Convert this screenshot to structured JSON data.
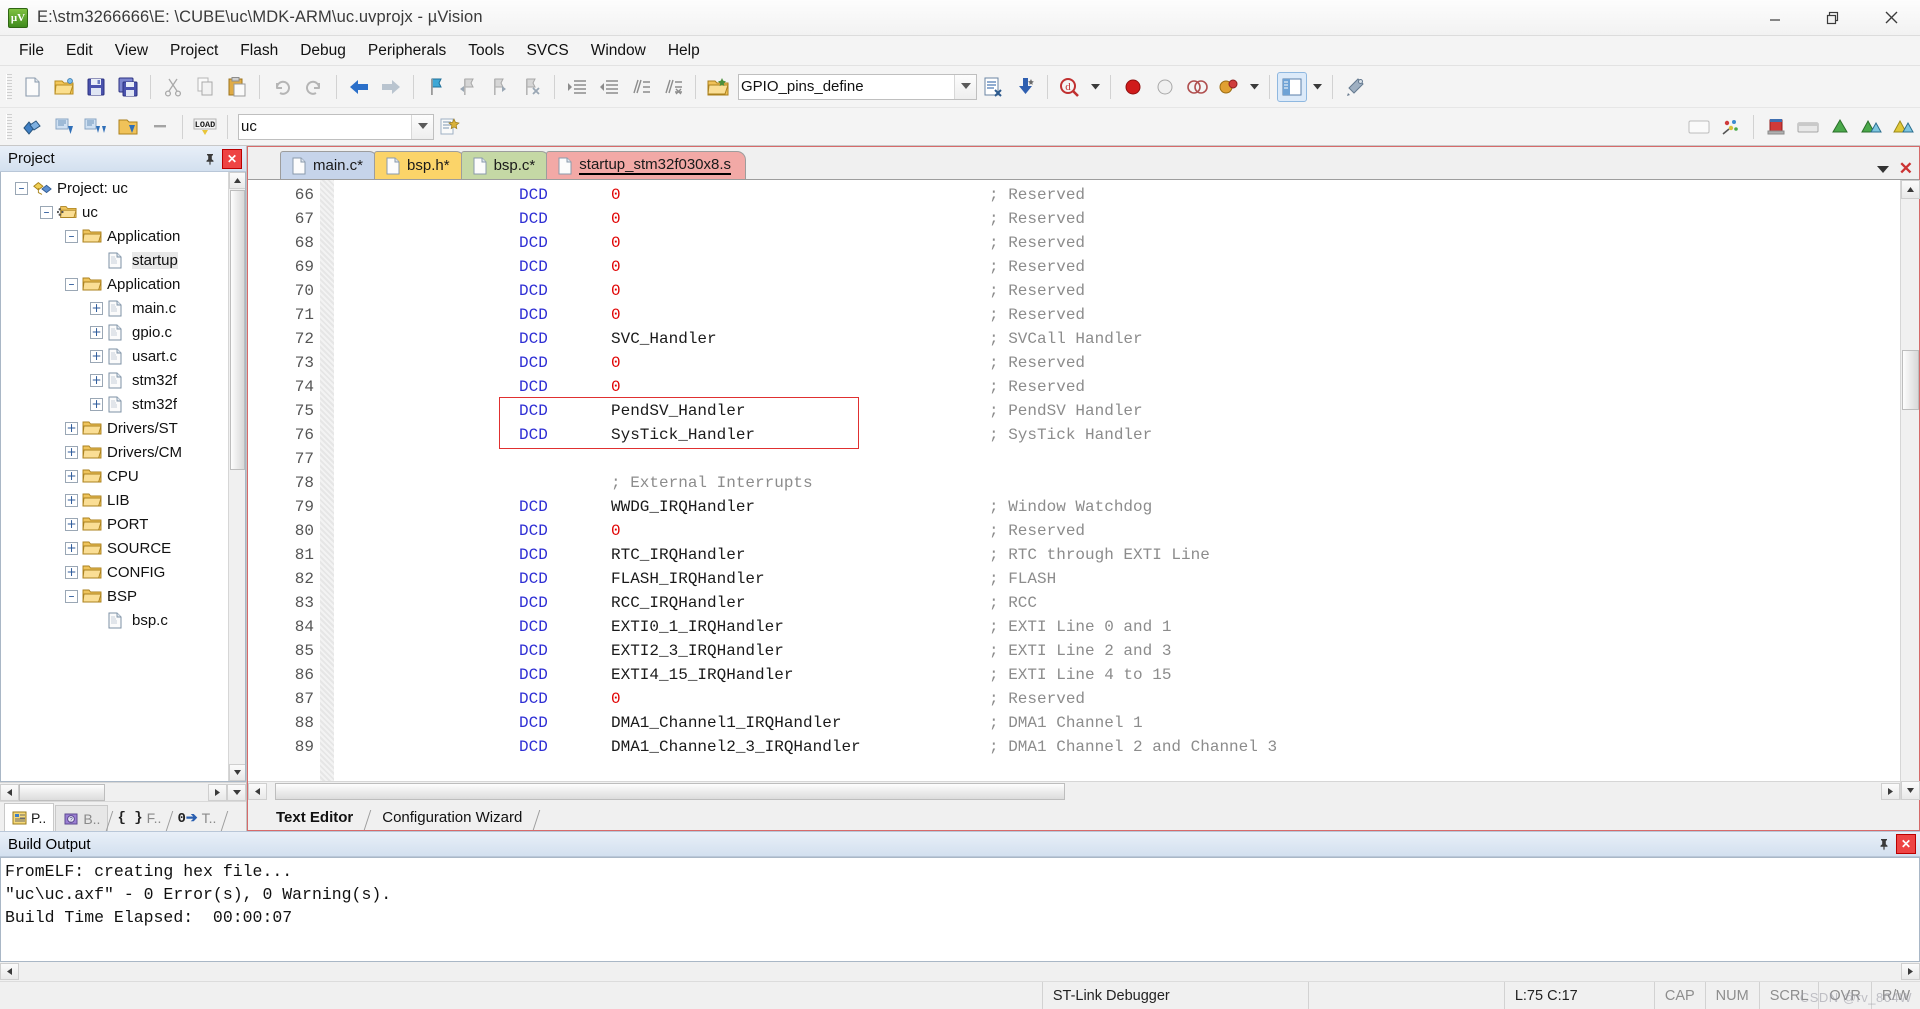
{
  "window": {
    "title": "E:\\stm3266666\\E:  \\CUBE\\uc\\MDK-ARM\\uc.uvprojx - µVision",
    "logo_text": "μV",
    "minimize_label": "Minimize",
    "maximize_label": "Restore",
    "close_label": "Close"
  },
  "menubar": {
    "items": [
      {
        "label": "File"
      },
      {
        "label": "Edit"
      },
      {
        "label": "View"
      },
      {
        "label": "Project"
      },
      {
        "label": "Flash"
      },
      {
        "label": "Debug"
      },
      {
        "label": "Peripherals"
      },
      {
        "label": "Tools"
      },
      {
        "label": "SVCS"
      },
      {
        "label": "Window"
      },
      {
        "label": "Help"
      }
    ]
  },
  "toolbar_main": {
    "buttons": [
      {
        "name": "new-file-icon",
        "title": "New"
      },
      {
        "name": "open-file-icon",
        "title": "Open"
      },
      {
        "name": "save-icon",
        "title": "Save"
      },
      {
        "name": "save-all-icon",
        "title": "Save All"
      },
      {
        "name": "cut-icon",
        "title": "Cut"
      },
      {
        "name": "copy-icon",
        "title": "Copy"
      },
      {
        "name": "paste-icon",
        "title": "Paste"
      },
      {
        "name": "undo-icon",
        "title": "Undo"
      },
      {
        "name": "redo-icon",
        "title": "Redo"
      },
      {
        "name": "navigate-back-icon",
        "title": "Back"
      },
      {
        "name": "navigate-forward-icon",
        "title": "Forward"
      },
      {
        "name": "bookmark-toggle-icon",
        "title": "Insert/Remove Bookmark"
      },
      {
        "name": "bookmark-prev-icon",
        "title": "Previous Bookmark"
      },
      {
        "name": "bookmark-next-icon",
        "title": "Next Bookmark"
      },
      {
        "name": "bookmark-clear-icon",
        "title": "Clear All Bookmarks"
      },
      {
        "name": "indent-icon",
        "title": "Indent"
      },
      {
        "name": "outdent-icon",
        "title": "Outdent"
      },
      {
        "name": "comment-icon",
        "title": "Comment"
      },
      {
        "name": "uncomment-icon",
        "title": "Uncomment"
      }
    ],
    "target_combo": {
      "value": "GPIO_pins_define",
      "icon": "target-options-icon"
    },
    "after_combo": [
      {
        "name": "target-options-icon",
        "title": "Options for Target"
      },
      {
        "name": "manage-runtime-icon",
        "title": "Manage Run-Time Environment"
      },
      {
        "name": "start-debug-icon",
        "title": "Start/Stop Debug Session"
      },
      {
        "name": "stop-icon",
        "title": "Stop"
      },
      {
        "name": "insert-breakpoint-icon",
        "title": "Insert/Remove Breakpoint"
      },
      {
        "name": "disable-breakpoint-icon",
        "title": "Enable/Disable Breakpoint"
      },
      {
        "name": "kill-breakpoints-icon",
        "title": "Kill All Breakpoints"
      },
      {
        "name": "window-layout-icon",
        "title": "Window Layout"
      },
      {
        "name": "configure-icon",
        "title": "Configuration"
      }
    ]
  },
  "toolbar_build": {
    "buttons": [
      {
        "name": "translate-icon",
        "title": "Translate"
      },
      {
        "name": "build-icon",
        "title": "Build"
      },
      {
        "name": "rebuild-icon",
        "title": "Rebuild"
      },
      {
        "name": "batch-build-icon",
        "title": "Batch Build"
      },
      {
        "name": "stop-build-icon",
        "title": "Stop Build"
      },
      {
        "name": "download-icon",
        "title": "Download (LOAD)"
      }
    ],
    "project_combo": {
      "value": "uc"
    },
    "right_buttons": [
      {
        "name": "target-options-icon",
        "title": "Options for Target"
      },
      {
        "name": "manage-components-icon",
        "title": "Manage Project Items"
      },
      {
        "name": "book-icon",
        "title": "Books"
      },
      {
        "name": "functions-icon",
        "title": "Functions"
      },
      {
        "name": "templates-icon",
        "title": "Templates"
      }
    ]
  },
  "project_panel": {
    "title": "Project",
    "pin_icon": "pin-icon",
    "close_icon": "close-icon",
    "tree": [
      {
        "depth": 0,
        "expander": "minus",
        "icon": "project-icon",
        "label": "Project: uc",
        "selected": false
      },
      {
        "depth": 1,
        "expander": "minus",
        "icon": "target-icon",
        "label": "uc",
        "selected": false
      },
      {
        "depth": 2,
        "expander": "minus",
        "icon": "folder-icon",
        "label": "Application",
        "selected": false
      },
      {
        "depth": 3,
        "expander": "none",
        "icon": "file-icon",
        "label": "startup",
        "selected": true
      },
      {
        "depth": 2,
        "expander": "minus",
        "icon": "folder-icon",
        "label": "Application",
        "selected": false
      },
      {
        "depth": 3,
        "expander": "plus",
        "icon": "file-icon",
        "label": "main.c",
        "selected": false
      },
      {
        "depth": 3,
        "expander": "plus",
        "icon": "file-icon",
        "label": "gpio.c",
        "selected": false
      },
      {
        "depth": 3,
        "expander": "plus",
        "icon": "file-icon",
        "label": "usart.c",
        "selected": false
      },
      {
        "depth": 3,
        "expander": "plus",
        "icon": "file-icon",
        "label": "stm32f",
        "selected": false
      },
      {
        "depth": 3,
        "expander": "plus",
        "icon": "file-icon",
        "label": "stm32f",
        "selected": false
      },
      {
        "depth": 2,
        "expander": "plus",
        "icon": "folder-icon",
        "label": "Drivers/ST",
        "selected": false
      },
      {
        "depth": 2,
        "expander": "plus",
        "icon": "folder-icon",
        "label": "Drivers/CM",
        "selected": false
      },
      {
        "depth": 2,
        "expander": "plus",
        "icon": "folder-icon",
        "label": "CPU",
        "selected": false
      },
      {
        "depth": 2,
        "expander": "plus",
        "icon": "folder-icon",
        "label": "LIB",
        "selected": false
      },
      {
        "depth": 2,
        "expander": "plus",
        "icon": "folder-icon",
        "label": "PORT",
        "selected": false
      },
      {
        "depth": 2,
        "expander": "plus",
        "icon": "folder-icon",
        "label": "SOURCE",
        "selected": false
      },
      {
        "depth": 2,
        "expander": "plus",
        "icon": "folder-icon",
        "label": "CONFIG",
        "selected": false
      },
      {
        "depth": 2,
        "expander": "minus",
        "icon": "folder-icon",
        "label": "BSP",
        "selected": false
      },
      {
        "depth": 3,
        "expander": "none",
        "icon": "file-icon",
        "label": "bsp.c",
        "selected": false
      }
    ],
    "bottom_tabs": [
      {
        "label": "P..",
        "icon": "project-tab-icon",
        "active": true
      },
      {
        "label": "B..",
        "icon": "books-tab-icon",
        "active": false
      },
      {
        "label": "F..",
        "icon": "functions-tab-icon",
        "active": false
      },
      {
        "label": "T..",
        "icon": "templates-tab-icon",
        "active": false
      }
    ]
  },
  "editor": {
    "tabs": [
      {
        "label": "main.c*",
        "color": "t-blue",
        "active": false
      },
      {
        "label": "bsp.h*",
        "color": "t-yellow",
        "active": false
      },
      {
        "label": "bsp.c*",
        "color": "t-green",
        "active": false
      },
      {
        "label": "startup_stm32f030x8.s",
        "color": "t-red",
        "active": true
      }
    ],
    "tab_menu_icon": "chevron-down-icon",
    "tab_close_icon": "close-icon",
    "first_line_number": 66,
    "lines": [
      {
        "n": 66,
        "dir": "DCD",
        "operand": "0",
        "operand_type": "num",
        "comment": "; Reserved"
      },
      {
        "n": 67,
        "dir": "DCD",
        "operand": "0",
        "operand_type": "num",
        "comment": "; Reserved"
      },
      {
        "n": 68,
        "dir": "DCD",
        "operand": "0",
        "operand_type": "num",
        "comment": "; Reserved"
      },
      {
        "n": 69,
        "dir": "DCD",
        "operand": "0",
        "operand_type": "num",
        "comment": "; Reserved"
      },
      {
        "n": 70,
        "dir": "DCD",
        "operand": "0",
        "operand_type": "num",
        "comment": "; Reserved"
      },
      {
        "n": 71,
        "dir": "DCD",
        "operand": "0",
        "operand_type": "num",
        "comment": "; Reserved"
      },
      {
        "n": 72,
        "dir": "DCD",
        "operand": "SVC_Handler",
        "operand_type": "sym",
        "comment": "; SVCall Handler"
      },
      {
        "n": 73,
        "dir": "DCD",
        "operand": "0",
        "operand_type": "num",
        "comment": "; Reserved"
      },
      {
        "n": 74,
        "dir": "DCD",
        "operand": "0",
        "operand_type": "num",
        "comment": "; Reserved"
      },
      {
        "n": 75,
        "dir": "DCD",
        "operand": "PendSV_Handler",
        "operand_type": "sym",
        "comment": "; PendSV Handler"
      },
      {
        "n": 76,
        "dir": "DCD",
        "operand": "SysTick_Handler",
        "operand_type": "sym",
        "comment": "; SysTick Handler"
      },
      {
        "n": 77,
        "dir": "",
        "operand": "",
        "operand_type": "none",
        "comment": ""
      },
      {
        "n": 78,
        "dir": "",
        "operand": "",
        "operand_type": "none",
        "comment": "; External Interrupts",
        "comment_inline": true
      },
      {
        "n": 79,
        "dir": "DCD",
        "operand": "WWDG_IRQHandler",
        "operand_type": "sym",
        "comment": "; Window Watchdog"
      },
      {
        "n": 80,
        "dir": "DCD",
        "operand": "0",
        "operand_type": "num",
        "comment": "; Reserved"
      },
      {
        "n": 81,
        "dir": "DCD",
        "operand": "RTC_IRQHandler",
        "operand_type": "sym",
        "comment": "; RTC through EXTI Line"
      },
      {
        "n": 82,
        "dir": "DCD",
        "operand": "FLASH_IRQHandler",
        "operand_type": "sym",
        "comment": "; FLASH"
      },
      {
        "n": 83,
        "dir": "DCD",
        "operand": "RCC_IRQHandler",
        "operand_type": "sym",
        "comment": "; RCC"
      },
      {
        "n": 84,
        "dir": "DCD",
        "operand": "EXTI0_1_IRQHandler",
        "operand_type": "sym",
        "comment": "; EXTI Line 0 and 1"
      },
      {
        "n": 85,
        "dir": "DCD",
        "operand": "EXTI2_3_IRQHandler",
        "operand_type": "sym",
        "comment": "; EXTI Line 2 and 3"
      },
      {
        "n": 86,
        "dir": "DCD",
        "operand": "EXTI4_15_IRQHandler",
        "operand_type": "sym",
        "comment": "; EXTI Line 4 to 15"
      },
      {
        "n": 87,
        "dir": "DCD",
        "operand": "0",
        "operand_type": "num",
        "comment": "; Reserved"
      },
      {
        "n": 88,
        "dir": "DCD",
        "operand": "DMA1_Channel1_IRQHandler",
        "operand_type": "sym",
        "comment": "; DMA1 Channel 1"
      },
      {
        "n": 89,
        "dir": "DCD",
        "operand": "DMA1_Channel2_3_IRQHandler",
        "operand_type": "sym",
        "comment": "; DMA1 Channel 2 and Channel 3"
      }
    ],
    "highlight": {
      "from_line": 75,
      "to_line": 76,
      "color": "#e03030"
    },
    "bottom_tabs": [
      {
        "label": "Text Editor",
        "active": true
      },
      {
        "label": "Configuration Wizard",
        "active": false
      }
    ]
  },
  "build_output": {
    "title": "Build Output",
    "pin_icon": "pin-icon",
    "close_icon": "close-icon",
    "lines": [
      "FromELF: creating hex file...",
      "\"uc\\uc.axf\" - 0 Error(s), 0 Warning(s).",
      "Build Time Elapsed:  00:00:07"
    ]
  },
  "statusbar": {
    "debugger": "ST-Link Debugger",
    "cursor": "L:75 C:17",
    "indicators": [
      "CAP",
      "NUM",
      "SCRL",
      "OVR",
      "R/W"
    ],
    "watermark": "CSDN @rv_804W"
  },
  "colors": {
    "accent_blue": "#2f2fd4",
    "number_red": "#e00000",
    "comment_gray": "#8c8c8c",
    "highlight_red": "#e03030",
    "tab_red": "#f2a9a6",
    "tab_green": "#c5d8a5",
    "tab_yellow": "#fbd469",
    "tab_blue": "#c6d4ea"
  }
}
